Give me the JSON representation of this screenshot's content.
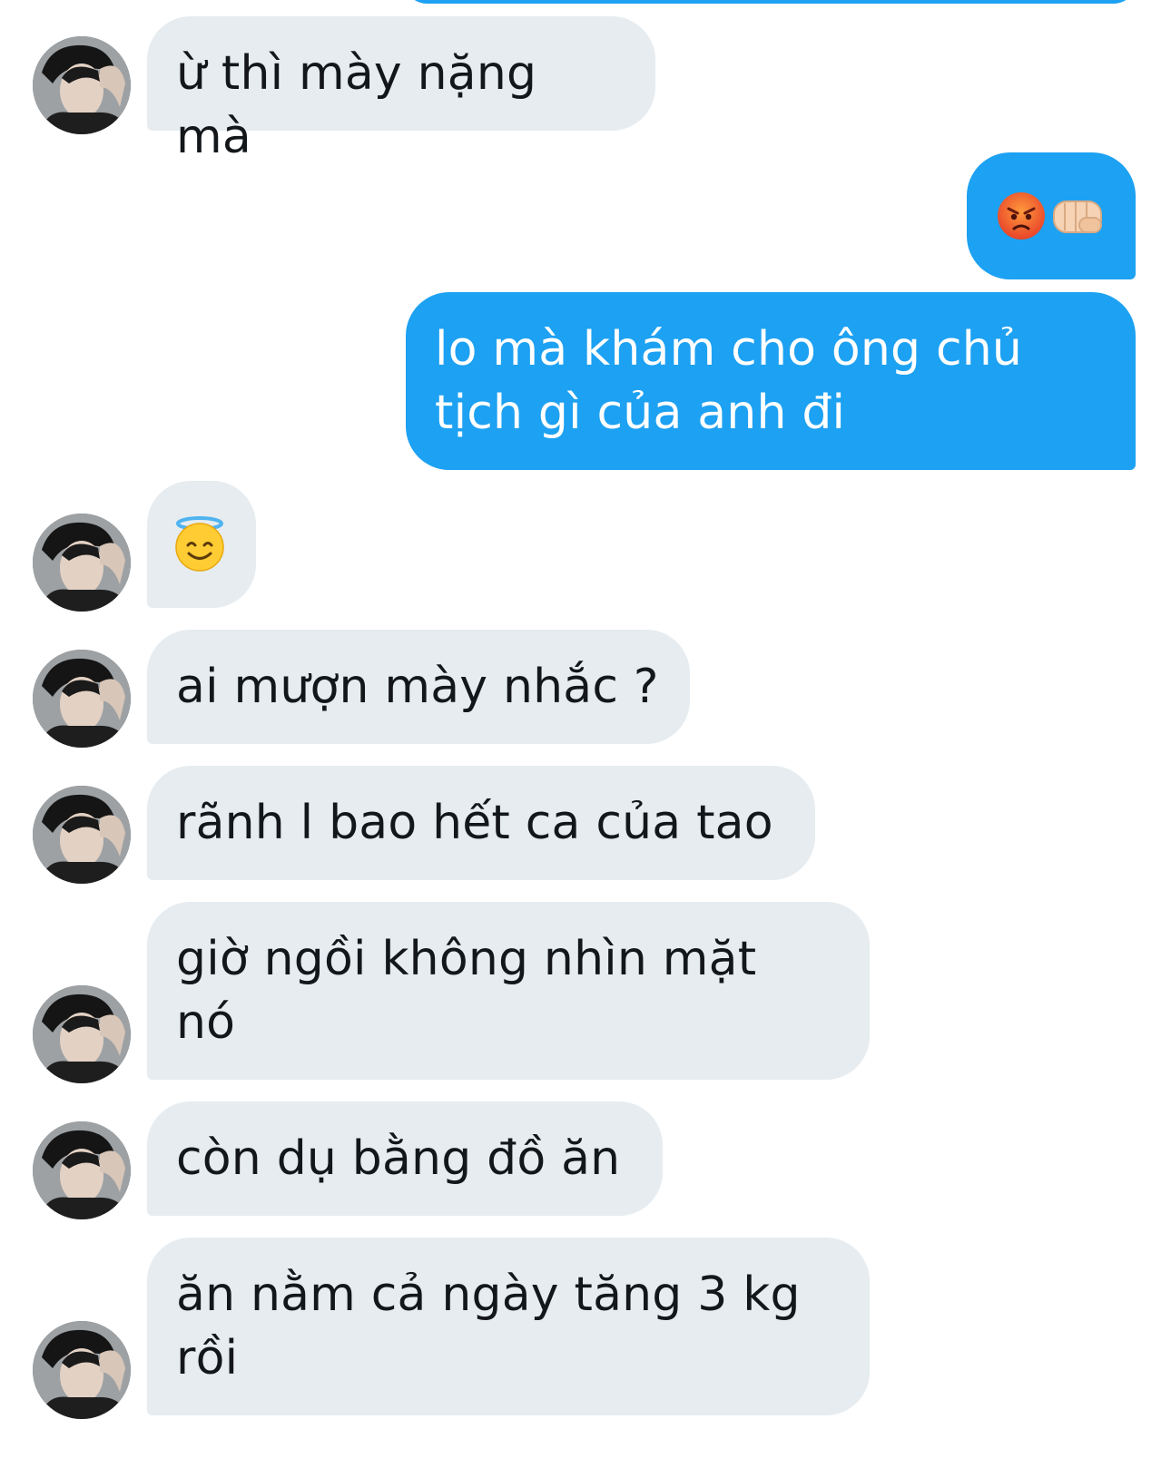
{
  "conversation": {
    "messages": [
      {
        "sender": "other",
        "text": "ừ thì mày nặng mà"
      },
      {
        "sender": "me",
        "emoji": [
          "pouting-face",
          "oncoming-fist"
        ]
      },
      {
        "sender": "me",
        "text": "lo mà khám cho ông chủ\ntịch gì của anh đi"
      },
      {
        "sender": "other",
        "emoji": [
          "smiling-face-with-halo"
        ]
      },
      {
        "sender": "other",
        "text": "ai mượn mày nhắc ?"
      },
      {
        "sender": "other",
        "text": "rãnh l bao hết ca của tao"
      },
      {
        "sender": "other",
        "text": "giờ ngồi không nhìn mặt\nnó"
      },
      {
        "sender": "other",
        "text": "còn dụ bằng đồ ăn"
      },
      {
        "sender": "other",
        "text": "ăn nằm cả ngày tăng 3 kg\nrồi"
      }
    ]
  },
  "colors": {
    "incoming_bubble": "#e6ecf0",
    "outgoing_bubble": "#1da1f2",
    "incoming_text": "#14171a",
    "outgoing_text": "#ffffff"
  }
}
